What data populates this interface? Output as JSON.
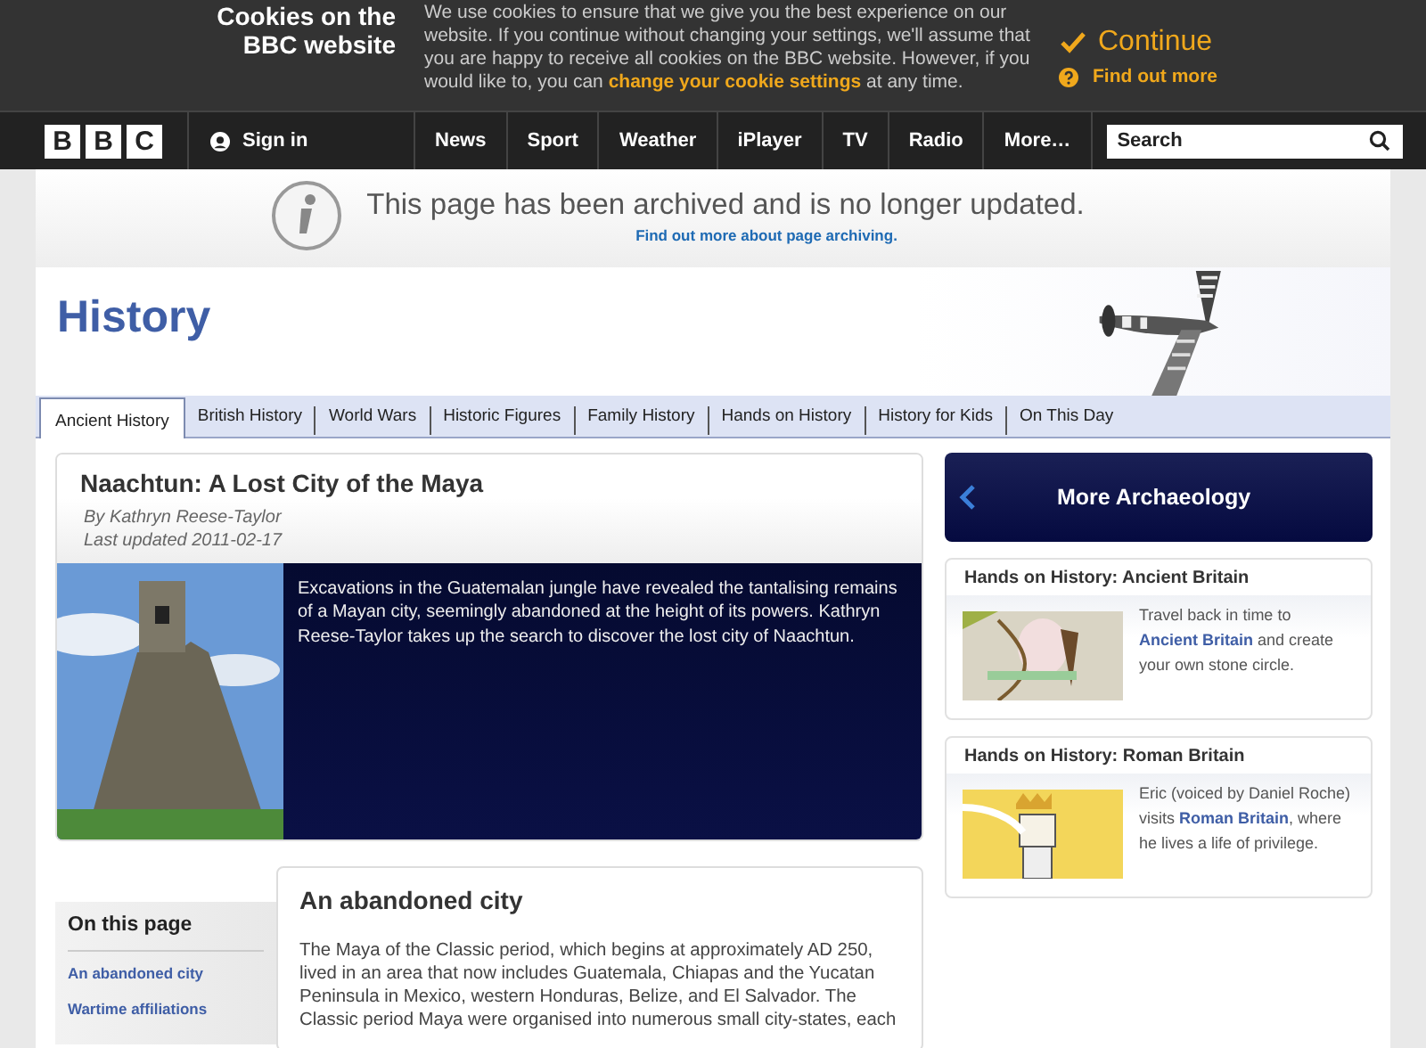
{
  "cookie_banner": {
    "title": "Cookies on the BBC website",
    "message": "We use cookies to ensure that we give you the best experience on our website. If you continue without changing your settings, we'll assume that you are happy to receive all cookies on the BBC website. However, if you would like to, you can **change your cookie settings** at any time.",
    "continue": "Continue",
    "find_out_more": "Find out more"
  },
  "nav": {
    "logo_letters": [
      "B",
      "B",
      "C"
    ],
    "sign_in": "Sign in",
    "items": [
      "News",
      "Sport",
      "Weather",
      "iPlayer",
      "TV",
      "Radio",
      "More…"
    ],
    "search": {
      "placeholder": "Search"
    }
  },
  "archive_notice": {
    "message": "This page has been archived and is no longer updated.",
    "link": "Find out more about page archiving."
  },
  "header": {
    "title": "History"
  },
  "tabs": [
    {
      "label": "Ancient History",
      "selected": true
    },
    {
      "label": "British History",
      "selected": false
    },
    {
      "label": "World Wars",
      "selected": false
    },
    {
      "label": "Historic Figures",
      "selected": false
    },
    {
      "label": "Family History",
      "selected": false
    },
    {
      "label": "Hands on History",
      "selected": false
    },
    {
      "label": "History for Kids",
      "selected": false
    },
    {
      "label": "On This Day",
      "selected": false
    }
  ],
  "article": {
    "title": "Naachtun: A Lost City of the Maya",
    "byline": "By Kathryn Reese-Taylor",
    "updated": "Last updated 2011-02-17",
    "summary": "Excavations in the Guatemalan jungle have revealed the tantalising remains of a Mayan city, seemingly abandoned at the height of its powers. Kathryn Reese-Taylor takes up the search to discover the lost city of Naachtun."
  },
  "more_panel": {
    "title": "More Archaeology",
    "promos": [
      {
        "title": "Hands on History: Ancient Britain",
        "before": "Travel back in time to ",
        "link": "Ancient Britain",
        "after": " and create your own stone circle."
      },
      {
        "title": "Hands on History: Roman Britain",
        "before": "Eric (voiced by Daniel Roche) visits ",
        "link": "Roman Britain",
        "after": ", where he lives a life of privilege."
      }
    ]
  },
  "on_this_page": {
    "title": "On this page",
    "links": [
      "An abandoned city",
      "Wartime affiliations"
    ]
  },
  "section": {
    "heading": "An abandoned city",
    "text": "The Maya of the Classic period, which begins at approximately AD 250, lived in an area that now includes Guatemala, Chiapas and the Yucatan Peninsula in Mexico, western Honduras, Belize, and El Salvador. The Classic period Maya were organised into numerous small city-states, each"
  }
}
